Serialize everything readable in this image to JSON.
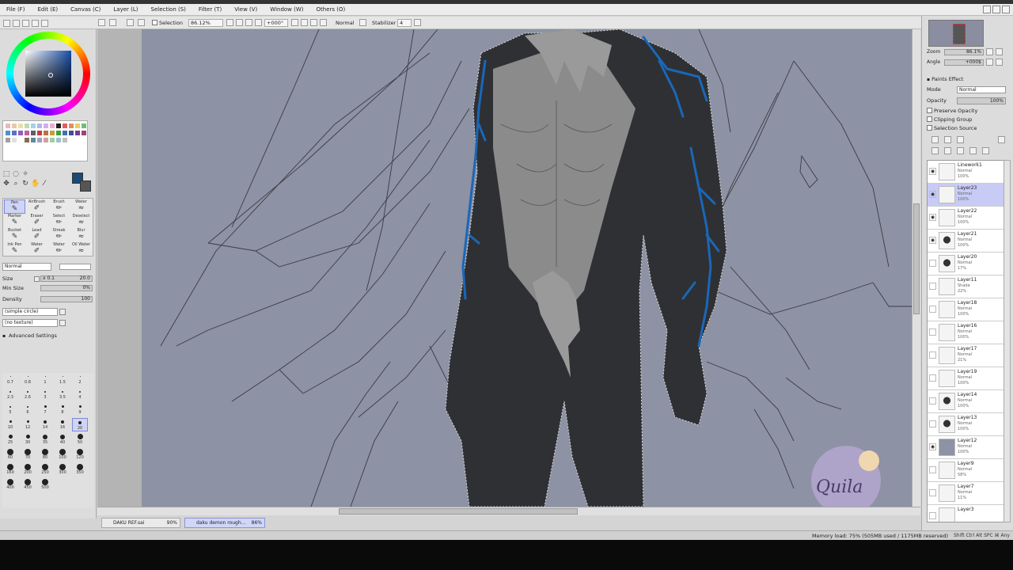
{
  "menu": [
    "File (F)",
    "Edit (E)",
    "Canvas (C)",
    "Layer (L)",
    "Selection (S)",
    "Filter (T)",
    "View (V)",
    "Window (W)",
    "Others (O)"
  ],
  "toolbar": {
    "selection_label": "Selection",
    "zoom": "86.12%",
    "angle": "+000°",
    "blend": "Normal",
    "stabilizer_label": "Stabilizer",
    "stabilizer_value": "4"
  },
  "tools": {
    "row1": [
      "Pen",
      "AirBrush",
      "Brush",
      "Water"
    ],
    "row2": [
      "Marker",
      "Eraser",
      "Select",
      "Deselect"
    ],
    "row3": [
      "Bucket",
      "Lead",
      "Streak",
      "Blur"
    ],
    "row4": [
      "Ink Pen",
      "Water",
      "Water",
      "Oil Water"
    ]
  },
  "brush": {
    "blend_mode": "Normal",
    "size_label": "Size",
    "size_mult": "x 0.1",
    "size_value": "20.0",
    "minsize_label": "Min Size",
    "minsize_value": "0%",
    "density_label": "Density",
    "density_value": "100",
    "shape": "(simple circle)",
    "texture": "(no texture)",
    "advanced": "Advanced Settings"
  },
  "sizes": [
    "0.7",
    "0.8",
    "1",
    "1.5",
    "2",
    "2.3",
    "2.6",
    "3",
    "3.5",
    "4",
    "5",
    "6",
    "7",
    "8",
    "9",
    "10",
    "12",
    "14",
    "16",
    "20",
    "25",
    "30",
    "35",
    "40",
    "50",
    "60",
    "70",
    "80",
    "100",
    "120",
    "160",
    "200",
    "250",
    "300",
    "350",
    "400",
    "450",
    "500"
  ],
  "navigator": {
    "zoom_label": "Zoom",
    "zoom_value": "86.1%",
    "angle_label": "Angle",
    "angle_value": "+000$"
  },
  "layer_panel": {
    "section_title": "Paints Effect",
    "mode_label": "Mode",
    "mode_value": "Normal",
    "opacity_label": "Opacity",
    "opacity_value": "100%",
    "preserve_opacity": "Preserve Opacity",
    "clipping_group": "Clipping Group",
    "selection_source": "Selection Source"
  },
  "layers": [
    {
      "name": "Linework1",
      "mode": "Normal",
      "opacity": "100%",
      "visible": true,
      "selected": false
    },
    {
      "name": "Layer23",
      "mode": "Normal",
      "opacity": "100%",
      "visible": true,
      "selected": true
    },
    {
      "name": "Layer22",
      "mode": "Normal",
      "opacity": "100%",
      "visible": true,
      "selected": false
    },
    {
      "name": "Layer21",
      "mode": "Normal",
      "opacity": "100%",
      "visible": true,
      "selected": false
    },
    {
      "name": "Layer20",
      "mode": "Normal",
      "opacity": "17%",
      "visible": false,
      "selected": false
    },
    {
      "name": "Layer11",
      "mode": "Shade",
      "opacity": "22%",
      "visible": false,
      "selected": false
    },
    {
      "name": "Layer18",
      "mode": "Normal",
      "opacity": "100%",
      "visible": false,
      "selected": false
    },
    {
      "name": "Layer16",
      "mode": "Normal",
      "opacity": "100%",
      "visible": false,
      "selected": false
    },
    {
      "name": "Layer17",
      "mode": "Normal",
      "opacity": "21%",
      "visible": false,
      "selected": false
    },
    {
      "name": "Layer19",
      "mode": "Normal",
      "opacity": "100%",
      "visible": false,
      "selected": false
    },
    {
      "name": "Layer14",
      "mode": "Normal",
      "opacity": "100%",
      "visible": false,
      "selected": false
    },
    {
      "name": "Layer13",
      "mode": "Normal",
      "opacity": "100%",
      "visible": false,
      "selected": false
    },
    {
      "name": "Layer12",
      "mode": "Normal",
      "opacity": "100%",
      "visible": true,
      "selected": false
    },
    {
      "name": "Layer9",
      "mode": "Normal",
      "opacity": "58%",
      "visible": false,
      "selected": false
    },
    {
      "name": "Layer7",
      "mode": "Normal",
      "opacity": "11%",
      "visible": false,
      "selected": false
    },
    {
      "name": "Layer3",
      "mode": "",
      "opacity": "",
      "visible": false,
      "selected": false
    }
  ],
  "tabs": [
    {
      "name": "DAKU REF.sai",
      "pct": "90%",
      "active": false
    },
    {
      "name": "daku demon rough...",
      "pct": "86%",
      "active": true
    }
  ],
  "status": {
    "memory": "Memory load: 75% (505MB used / 1175MB reserved)",
    "icons": "Shift Ctrl Alt SPC ⌘ Any"
  },
  "watermark": "Quila",
  "colors": {
    "canvas_bg": "#8d92a4",
    "body_dark": "#2f3033",
    "chest_grey": "#8c8c8c",
    "vein_blue": "#1a67b8",
    "primary": "#1a4a78"
  }
}
